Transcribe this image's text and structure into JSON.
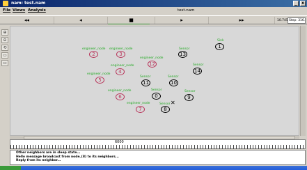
{
  "window": {
    "title": "nam: test.nam"
  },
  "menu": {
    "items": [
      "File",
      "Views",
      "Analysis"
    ],
    "doc_name": "test.nam"
  },
  "toolbar": {
    "buttons": [
      "◂◂",
      "◂",
      "■",
      "▸",
      "▸▸"
    ],
    "time": "10.745258",
    "step": "Step: 316.2us"
  },
  "palette": [
    "⊕",
    "⊖",
    "⟲",
    "▭",
    "▭"
  ],
  "nodes": [
    {
      "id": "1",
      "state": "awake",
      "label": "Sink"
    },
    {
      "id": "2",
      "state": "sleep",
      "label": "engineer_node"
    },
    {
      "id": "3",
      "state": "sleep",
      "label": "engineer_node"
    },
    {
      "id": "4",
      "state": "sleep",
      "label": "engineer_node"
    },
    {
      "id": "5",
      "state": "sleep",
      "label": "engineer_node"
    },
    {
      "id": "6",
      "state": "sleep",
      "label": "engineer_node"
    },
    {
      "id": "7",
      "state": "sleep",
      "label": "engineer_node"
    },
    {
      "id": "8",
      "state": "awake",
      "label": "Sensor"
    },
    {
      "id": "9",
      "state": "awake",
      "label": "Sensor"
    },
    {
      "id": "10",
      "state": "awake",
      "label": "Sensor"
    },
    {
      "id": "11",
      "state": "awake",
      "label": "Sensor"
    },
    {
      "id": "12",
      "state": "sleep",
      "label": "engineer_node"
    },
    {
      "id": "13",
      "state": "awake",
      "label": "Sensor"
    },
    {
      "id": "14",
      "state": "awake",
      "label": "Sensor"
    },
    {
      "id": "0",
      "state": "awake",
      "label": "Sensor"
    }
  ],
  "timeline": {
    "label": "6000"
  },
  "log": [
    "Other neighbors are in sleep state...",
    "Hello message broadcast from node_(8) to its neighbors...",
    "Reply from its neighbor..."
  ],
  "colors": {
    "sleep": "#b8345a",
    "label": "#22aa22",
    "canvas": "#d8d8d8"
  }
}
